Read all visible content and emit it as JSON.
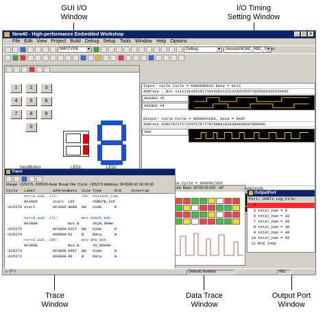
{
  "callouts": {
    "gui_io": "GUI  I/O\nWindow",
    "io_timing": "I/O Timing\nSetting Window",
    "trace": "Trace\nWindow",
    "data_trace": "Data Trace\nWindow",
    "output_port": "Output Port\nWindow"
  },
  "app": {
    "title": "New40 - High-performance Embedded Workshop",
    "menus": [
      "File",
      "Edit",
      "View",
      "Project",
      "Build",
      "Debug",
      "Setup",
      "Tools",
      "Window",
      "Help",
      "Options"
    ],
    "config_combo": "M40TYPE",
    "session_combo": "Debug",
    "target_combo": "SessionM16C_R8C_Simul"
  },
  "gui_window": {
    "keypad": [
      "1",
      "2",
      "3",
      "4",
      "5",
      "6",
      "7",
      "8",
      "9",
      "0"
    ],
    "input_caption": "InputButton",
    "led1_caption": "LED1",
    "led2_caption": "LED2"
  },
  "io_window": {
    "input": {
      "header": "Input: cycle          Cycle = 0000000033  Data = 0x33",
      "address_line": "Address : Bit  11121314151617181920212223242526272829303132333435",
      "rows": [
        "0003E0  #5",
        "0003E0  #4"
      ]
    },
    "output": {
      "header": "Output: cycle          Cycle = 0000041268, Data = 0x6F",
      "address_line": "Address   4363707172737475767778798081828384858687888990",
      "row_label": "3em"
    },
    "interrupt": {
      "header": "Interrupt: cycle       Cycle = 0000027265",
      "vec_line": "Vec. : Pri.  14719000200001720001300001400001600001800"
    }
  },
  "trace_window": {
    "title": "Trace",
    "range_line": "Range: -025276, 000000    Area: Break  File:   Cycle: -025276 Address: 0F3006   00 00 00 00",
    "columns": [
      "Cycle",
      "Label",
      "Address",
      "Data",
      "Size",
      "Type",
      "R/W",
      "Interrup"
    ],
    "rows": [
      {
        "cycle": "",
        "label": "ncrt0.a30, 172:",
        "address": "",
        "data": "",
        "size": "ldc",
        "type": "#istack_top,",
        "rw": "",
        "intr": ""
      },
      {
        "cycle": "",
        "label": "0F3006",
        "address": "start",
        "data": "LDC",
        "size": "",
        "type": "#0B07B,ISP",
        "rw": "",
        "intr": ""
      },
      {
        "cycle": "-025276",
        "label": "start",
        "address": "0F3006",
        "data": "40EB",
        "size": "DW",
        "type": "Code",
        "rw": "R",
        "intr": ""
      },
      {
        "cycle": "",
        "label": "",
        "address": "",
        "data": "",
        "size": "",
        "type": "",
        "rw": "",
        "intr": ""
      },
      {
        "cycle": "",
        "label": "ncrt0.a30, 171:",
        "address": "",
        "data": "",
        "size": "mov.b",
        "type": "#02h,04h",
        "rw": "",
        "intr": ""
      },
      {
        "cycle": "",
        "label": "0F300A",
        "address": "",
        "data": "mov.B",
        "size": "",
        "type": "#02H,004H",
        "rw": "",
        "intr": ""
      },
      {
        "cycle": "-025275",
        "label": "",
        "address": "0F300A",
        "data": "02C7",
        "size": "DW",
        "type": "Code",
        "rw": "R",
        "intr": ""
      },
      {
        "cycle": "-025274",
        "label": "",
        "address": "00000A",
        "data": "02",
        "size": "B",
        "type": "Data",
        "rw": "W",
        "intr": ""
      },
      {
        "cycle": "",
        "label": "ncrt0.a30, 180:",
        "address": "",
        "data": "",
        "size": "mov.b",
        "type": "#0,0Ah",
        "rw": "",
        "intr": ""
      },
      {
        "cycle": "",
        "label": "0F300E",
        "address": "",
        "data": "mov.B",
        "size": "",
        "type": "#0,0004H",
        "rw": "",
        "intr": ""
      },
      {
        "cycle": "-025273",
        "label": "",
        "address": "0F300E",
        "data": "0487",
        "size": "DW",
        "type": "Code",
        "rw": "R",
        "intr": ""
      },
      {
        "cycle": "-025272",
        "label": "",
        "address": "00000A",
        "data": "00",
        "size": "B",
        "type": "Data",
        "rw": "W",
        "intr": ""
      }
    ]
  },
  "data_trace_window": {
    "header": "Point:  Mark: 00\"00:00.005 - 00\""
  },
  "output_port_window": {
    "title": "OutputPort",
    "header": "Port: UART1    Log File:",
    "rows": [
      {
        "n": "4",
        "text": ""
      },
      {
        "n": "5",
        "text": "total_num = 0"
      },
      {
        "n": "6",
        "text": "total_num = 10"
      },
      {
        "n": "7",
        "text": "total_num = 20"
      },
      {
        "n": "8",
        "text": "total_num = 30"
      },
      {
        "n": "9",
        "text": "total_num = 40"
      },
      {
        "n": "10",
        "text": "total_num = 50"
      },
      {
        "n": "11",
        "text": "End loop"
      }
    ]
  },
  "statusbar": {
    "left": "レディ",
    "session": "Default| desktop",
    "ins": "INS"
  },
  "colors": {
    "led_red": "#e00000",
    "led_blue": "#1a4fd0",
    "title_blue": "#0a246a",
    "wave_yellow": "#ffd800",
    "output_port_red": "#ff2a2a"
  }
}
